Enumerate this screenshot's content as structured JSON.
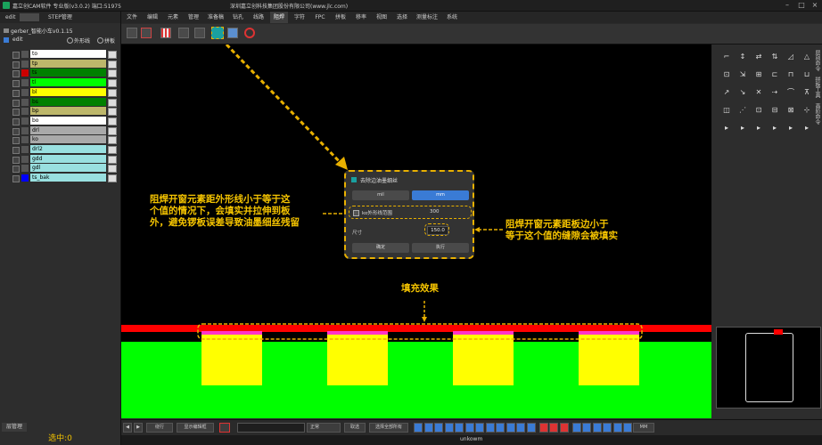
{
  "titlebar": {
    "app_title": "嘉立创CAM软件 专业版(v3.0.2) 端口:51975",
    "company": "深圳嘉立创科技集团股份有限公司(www.jlc.com)"
  },
  "left_panel": {
    "tabs": [
      "edit",
      "STEP管理"
    ],
    "job_name": "gerber_智能小车v0.1.15",
    "edit_label": "edit",
    "outline_label": "外形线",
    "panel_label": "拼板",
    "layers": [
      {
        "name": "to",
        "color": "#ffffff",
        "swatch": "#555555"
      },
      {
        "name": "tp",
        "color": "#bdb76b",
        "swatch": "#555555"
      },
      {
        "name": "ts",
        "color": "#008000",
        "swatch": "#cc0000"
      },
      {
        "name": "tl",
        "color": "#00ff00",
        "swatch": "#555555"
      },
      {
        "name": "bl",
        "color": "#ffff00",
        "swatch": "#555555"
      },
      {
        "name": "bs",
        "color": "#008000",
        "swatch": "#555555"
      },
      {
        "name": "bp",
        "color": "#bdb76b",
        "swatch": "#555555"
      },
      {
        "name": "bo",
        "color": "#ffffff",
        "swatch": "#555555"
      },
      {
        "name": "drl",
        "color": "#a9a9a9",
        "swatch": "#555555"
      },
      {
        "name": "ko",
        "color": "#a9a9a9",
        "swatch": "#555555"
      },
      {
        "name": "drl2",
        "color": "#99e0e0",
        "swatch": "#555555"
      },
      {
        "name": "gdd",
        "color": "#99e0e0",
        "swatch": "#555555"
      },
      {
        "name": "gdl",
        "color": "#99e0e0",
        "swatch": "#555555"
      },
      {
        "name": "ts_bak",
        "color": "#99e0e0",
        "swatch": "#0000ff"
      }
    ],
    "bottom_tab": "层管理",
    "selected_count": "选中:0"
  },
  "menu": [
    "文件",
    "编辑",
    "元素",
    "管理",
    "准备稿",
    "钻孔",
    "线路",
    "阻焊",
    "字符",
    "FPC",
    "拼板",
    "移率",
    "视图",
    "选择",
    "测量标注",
    "系统"
  ],
  "menu_selected_index": 7,
  "toolbar_icons": [
    "pen-icon",
    "pen-red-icon",
    "stripes-icon",
    "printer-icon",
    "pencil-icon",
    "fill-solder-icon",
    "grid-fill-icon",
    "stop-icon"
  ],
  "dialog": {
    "title": "去除边油墨细丝",
    "unit_mil": "mil",
    "unit_mm": "mm",
    "ko_label": "ko外形线范围",
    "ko_value": "300",
    "size_label": "尺寸",
    "size_value": "150.0",
    "ok": "确定",
    "execute": "执行"
  },
  "annotations": {
    "left_lines": [
      "阻焊开窗元素距外形线小于等于这",
      "个值的情况下，会填实并拉伸到板",
      "外，避免锣板误差导致油墨细丝残留"
    ],
    "right_lines": [
      "阻焊开窗元素距板边小于",
      "等于这个值的缝隙会被填实"
    ],
    "fill_effect": "填充效果"
  },
  "right_panel": {
    "labels": [
      "层别命令",
      "拼板工具",
      "高阶命令"
    ]
  },
  "bottombar": {
    "mode": "绕行",
    "display_btn": "显示编辑框",
    "edit_mode": "正常",
    "select_btn": "取选",
    "select_all_btn": "选择全部所有",
    "unit": "MM"
  },
  "statusbar": "unkowm",
  "colors": {
    "accent": "#e8b000",
    "annotation": "#f5c400",
    "dialog_unit_selected": "#3a7bd5"
  }
}
